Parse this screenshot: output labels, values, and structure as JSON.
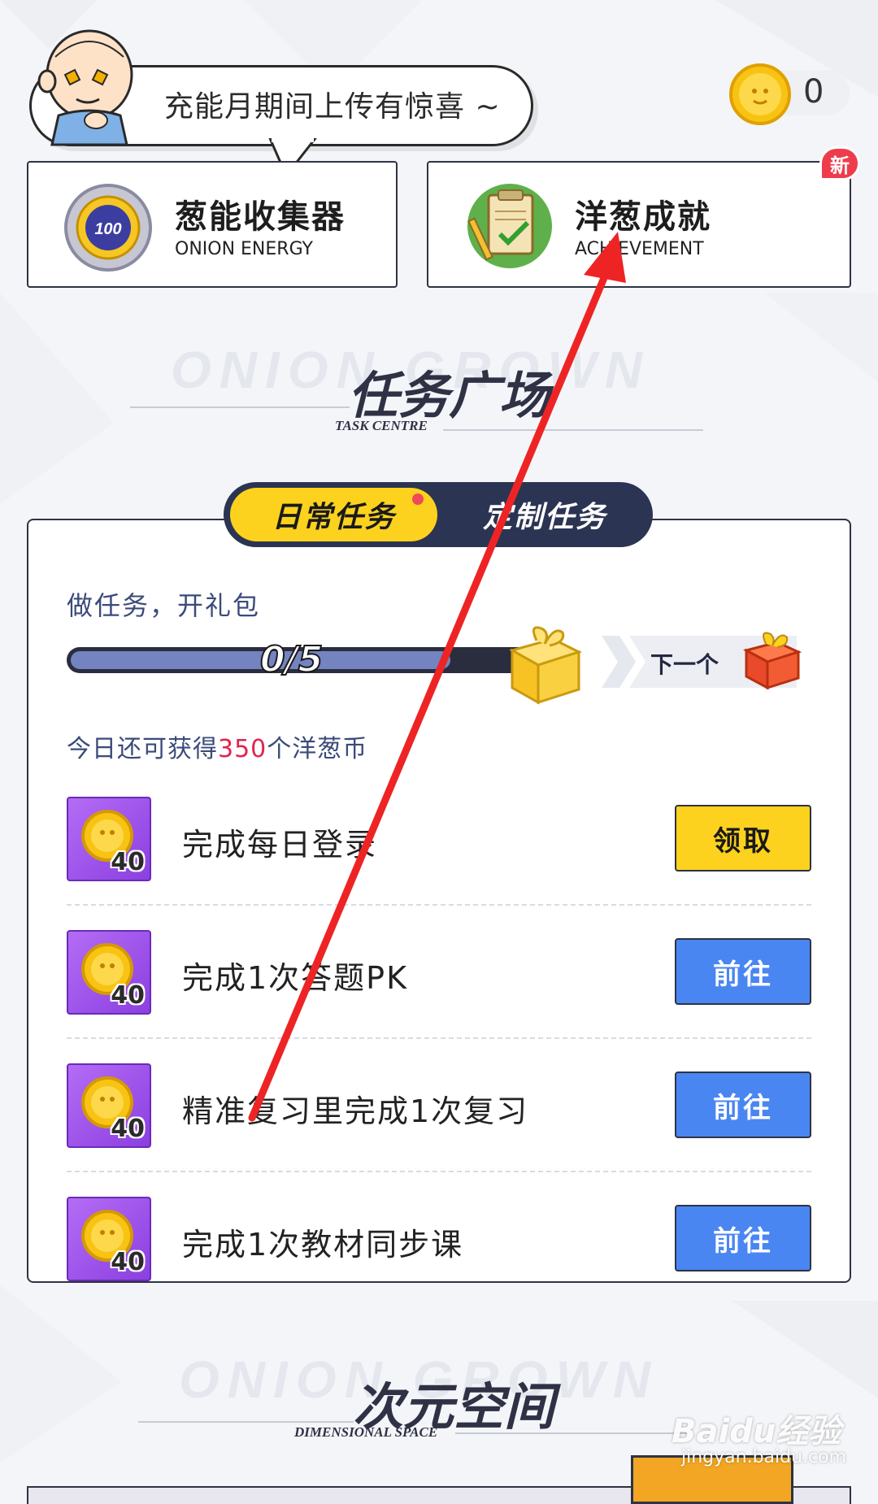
{
  "header": {
    "bubble_text": "充能月期间上传有惊喜 ~",
    "coin_count": "0"
  },
  "cards": {
    "energy": {
      "title": "葱能收集器",
      "subtitle": "ONION ENERGY",
      "badge_value": "100"
    },
    "achievement": {
      "title": "洋葱成就",
      "subtitle": "ACHIEVEMENT",
      "badge": "新"
    }
  },
  "task_section": {
    "watermark": "ONION GROWN",
    "title": "任务广场",
    "subtitle": "TASK CENTRE"
  },
  "tabs": [
    {
      "label": "日常任务",
      "active": true
    },
    {
      "label": "定制任务",
      "active": false
    }
  ],
  "panel": {
    "label": "做任务，开礼包",
    "progress_text": "0/5",
    "progress_fraction": 0.82,
    "next_label": "下一个",
    "earn_prefix": "今日还可获得",
    "earn_amount": "350",
    "earn_suffix": "个洋葱币"
  },
  "tasks": [
    {
      "reward": "40",
      "label": "完成每日登录",
      "button": "领取",
      "button_style": "yellow"
    },
    {
      "reward": "40",
      "label": "完成1次答题PK",
      "button": "前往",
      "button_style": "blue"
    },
    {
      "reward": "40",
      "label": "精准复习里完成1次复习",
      "button": "前往",
      "button_style": "blue"
    },
    {
      "reward": "40",
      "label": "完成1次教材同步课",
      "button": "前往",
      "button_style": "blue"
    }
  ],
  "space_section": {
    "watermark": "ONION GROWN",
    "title": "次元空间",
    "subtitle": "DIMENSIONAL SPACE"
  },
  "watermark_site": {
    "logo": "Baidu经验",
    "url": "jingyan.baidu.com"
  },
  "colors": {
    "accent_yellow": "#fcd21e",
    "button_blue": "#4a86f2",
    "navy": "#2b3452",
    "highlight_red": "#e0244c"
  }
}
